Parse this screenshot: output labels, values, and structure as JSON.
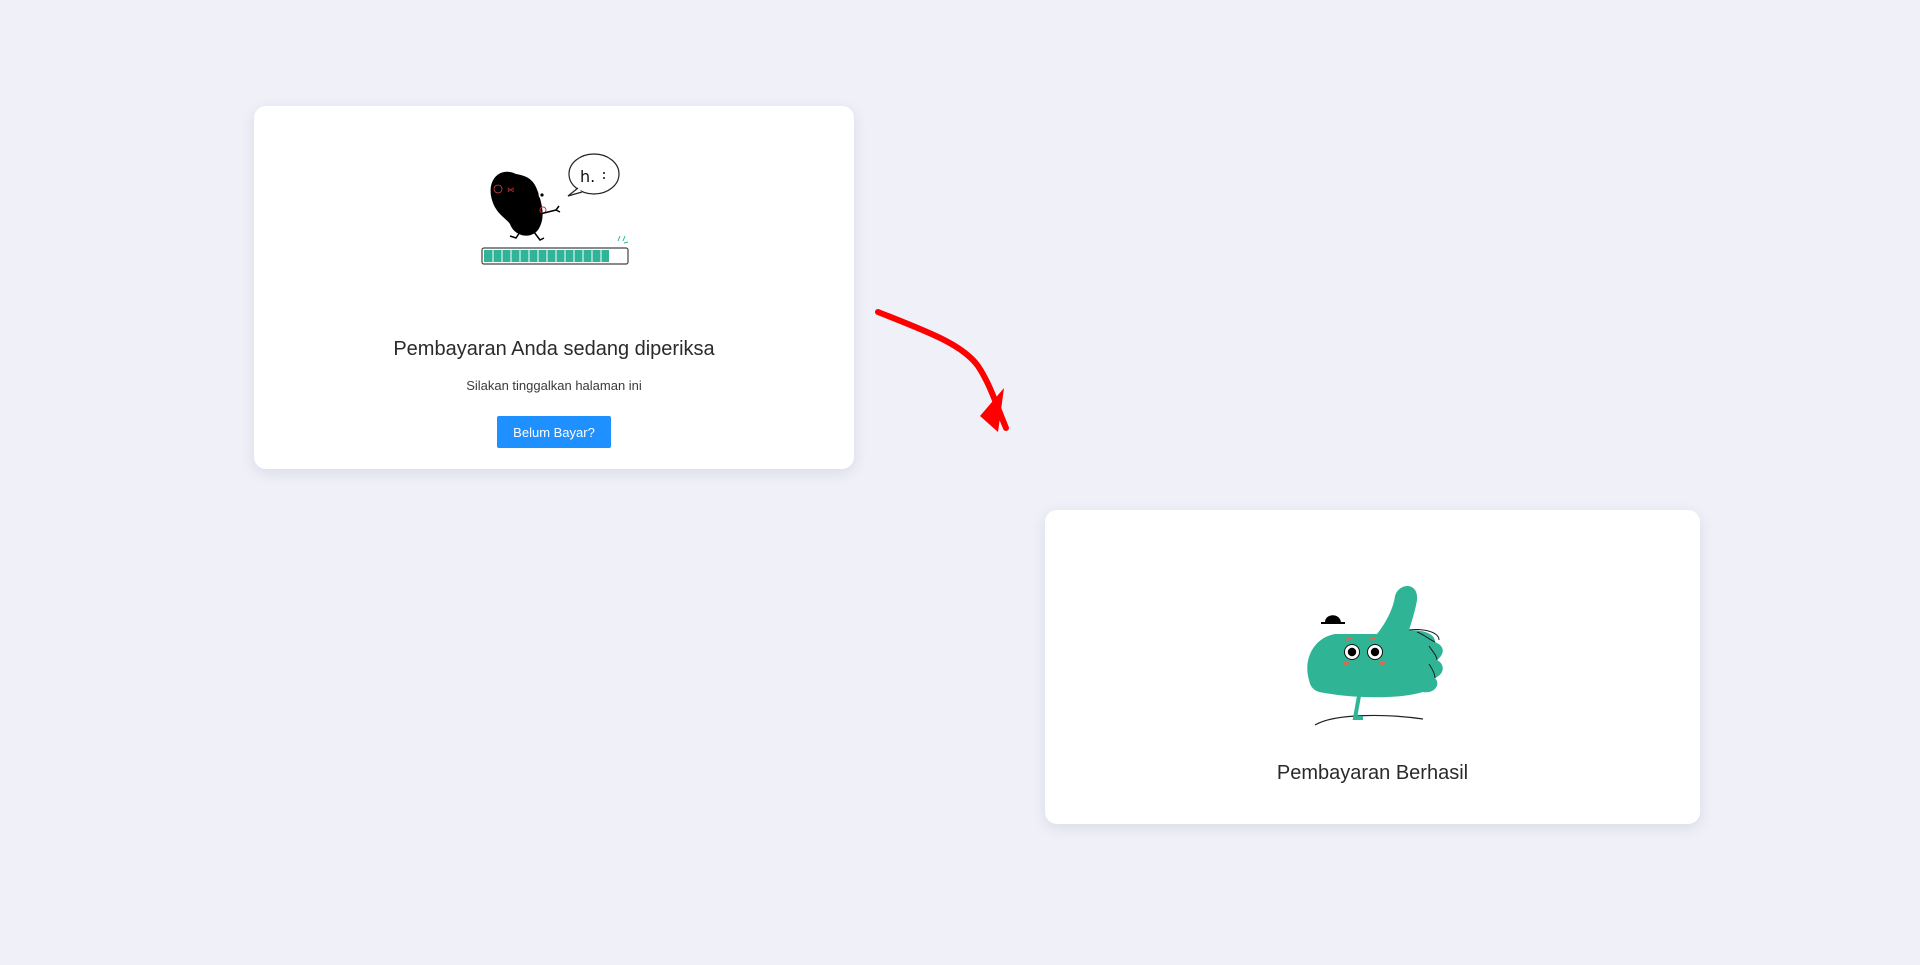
{
  "pending_card": {
    "title": "Pembayaran Anda sedang diperiksa",
    "subtitle": "Silakan tinggalkan halaman ini",
    "button_label": "Belum Bayar?",
    "illustration": {
      "icon": "loading-character-icon",
      "speech_text": "h.",
      "progress": 0.88
    }
  },
  "success_card": {
    "title": "Pembayaran Berhasil",
    "illustration": {
      "icon": "thumbs-up-character-icon"
    }
  },
  "annotation": {
    "icon": "arrow-icon",
    "color": "#ff0000"
  },
  "colors": {
    "background": "#eff0f8",
    "card": "#ffffff",
    "button": "#1e90ff",
    "accent_green": "#2fb596"
  }
}
